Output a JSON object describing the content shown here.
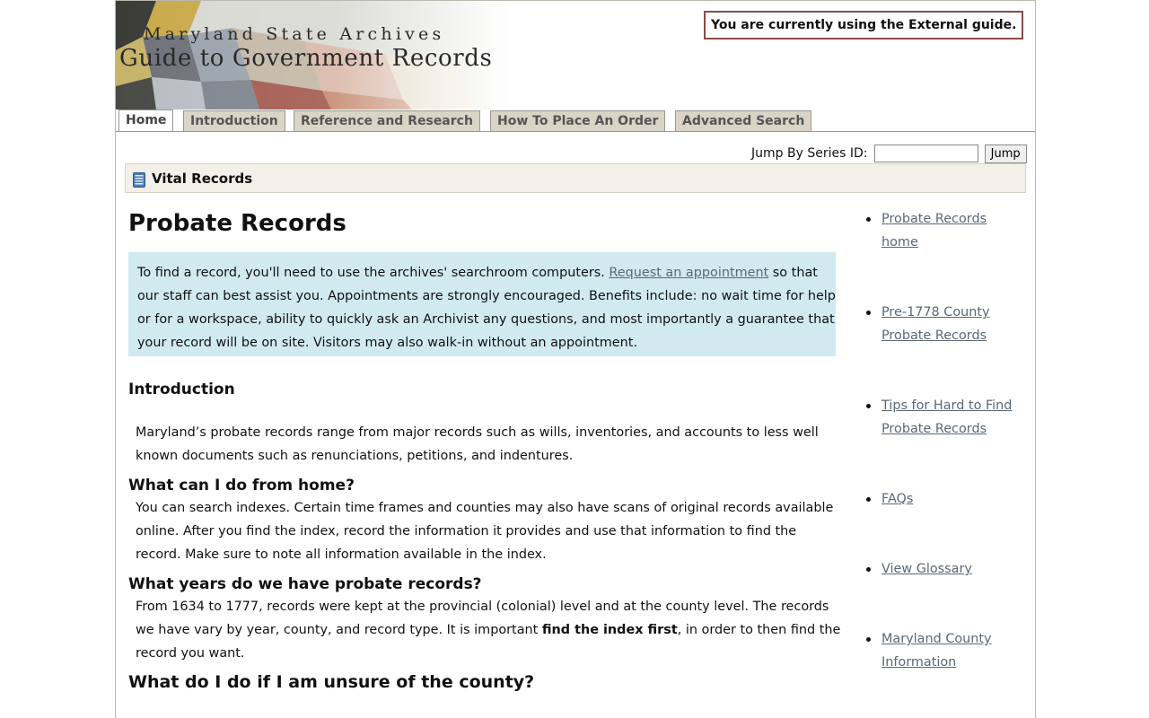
{
  "header": {
    "org_name": "Maryland State Archives",
    "site_title": "Guide to Government Records",
    "guide_notice": "You are currently using the External guide."
  },
  "tabs": [
    {
      "label": "Home",
      "active": true
    },
    {
      "label": "Introduction",
      "active": false
    },
    {
      "label": "Reference and Research",
      "active": false
    },
    {
      "label": "How To Place An Order",
      "active": false
    },
    {
      "label": "Advanced Search",
      "active": false
    }
  ],
  "jump": {
    "label": "Jump By Series ID:",
    "input_value": "",
    "button_label": "Jump"
  },
  "section": {
    "title": "Vital Records",
    "icon": "book-icon"
  },
  "main": {
    "page_title": "Probate Records",
    "notice": {
      "text_before": "To find a record, you'll need to use the archives' searchroom computers. ",
      "link_text": "Request an appointment",
      "text_after": " so that our staff can best assist you. Appointments are strongly encouraged. Benefits include: no wait time for help or for a workspace, ability to quickly ask an Archivist any questions, and most importantly a guarantee that your record will be on site. Visitors may also walk-in without an appointment."
    },
    "intro_heading": "Introduction",
    "intro_text": "Maryland’s probate records range from major records such as wills, inventories, and accounts to less well known documents such as renunciations, petitions, and indentures.",
    "home_heading": "What can I do from home?",
    "home_text": "You can search indexes. Certain time frames and counties may also have scans of original records available online. After you find the index, record the information it provides and use that information to find the record. Make sure to note all information available in the index.",
    "years_heading": "What years do we have probate records?",
    "years_text_before": "From 1634 to 1777, records were kept at the provincial (colonial) level and at the county level. The records we have vary by year, county, and record type. It is important ",
    "years_text_bold": "find the index first",
    "years_text_after": ", in order to then find the record you want.",
    "county_heading": "What do I do if I am unsure of the county?"
  },
  "sidebar": {
    "items": [
      "Probate Records home",
      "Pre-1778 County Probate Records",
      "Tips for Hard to Find Probate Records",
      "FAQs",
      "View Glossary",
      "Maryland County Information"
    ]
  },
  "colors": {
    "link": "#5a6878",
    "notice_bg": "#d1eaf0",
    "section_bar_bg": "#f2f0e8",
    "tab_bg": "#d8d4c6",
    "notice_border": "#8a4a4a"
  }
}
